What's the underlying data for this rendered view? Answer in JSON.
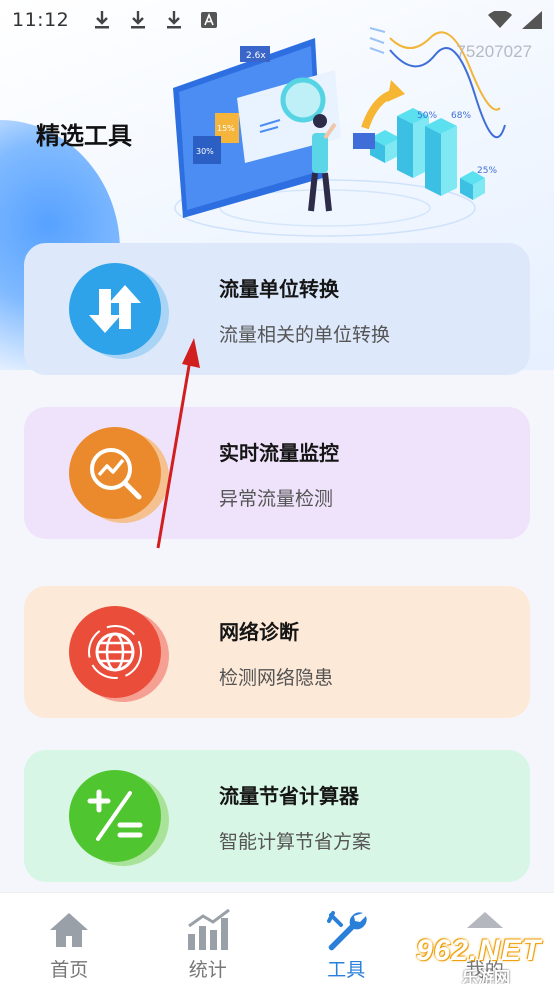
{
  "status_bar": {
    "time": "11:12",
    "icons": [
      "download-icon",
      "download-icon",
      "download-icon",
      "app-a-icon"
    ],
    "right_icons": [
      "wifi-icon",
      "signal-icon"
    ]
  },
  "watermark": "75207027",
  "page_title": "精选工具",
  "illustration": {
    "labels": [
      "2.6x",
      "15%",
      "30%",
      "50%",
      "68%",
      "25%"
    ]
  },
  "cards": [
    {
      "title": "流量单位转换",
      "subtitle": "流量相关的单位转换",
      "icon": "swap-arrows-icon",
      "bg": "#dde9fb",
      "accent": "#2ea3ea"
    },
    {
      "title": "实时流量监控",
      "subtitle": "异常流量检测",
      "icon": "trend-magnifier-icon",
      "bg": "#efe3fb",
      "accent": "#ea8a2c"
    },
    {
      "title": "网络诊断",
      "subtitle": "检测网络隐患",
      "icon": "globe-icon",
      "bg": "#fde9d8",
      "accent": "#ea4d3a"
    },
    {
      "title": "流量节省计算器",
      "subtitle": "智能计算节省方案",
      "icon": "plus-minus-icon",
      "bg": "#d8f6e5",
      "accent": "#4fc52f"
    }
  ],
  "bottom_nav": [
    {
      "label": "首页",
      "icon": "home-icon",
      "active": false
    },
    {
      "label": "统计",
      "icon": "bar-chart-icon",
      "active": false
    },
    {
      "label": "工具",
      "icon": "wrench-icon",
      "active": true
    },
    {
      "label": "我的",
      "icon": "user-icon",
      "active": false
    }
  ],
  "brand_badge": {
    "text": "962.NET",
    "sub": "乐游网"
  },
  "colors": {
    "active_nav": "#2a7fd8",
    "annotation_arrow": "#d11f1f"
  }
}
